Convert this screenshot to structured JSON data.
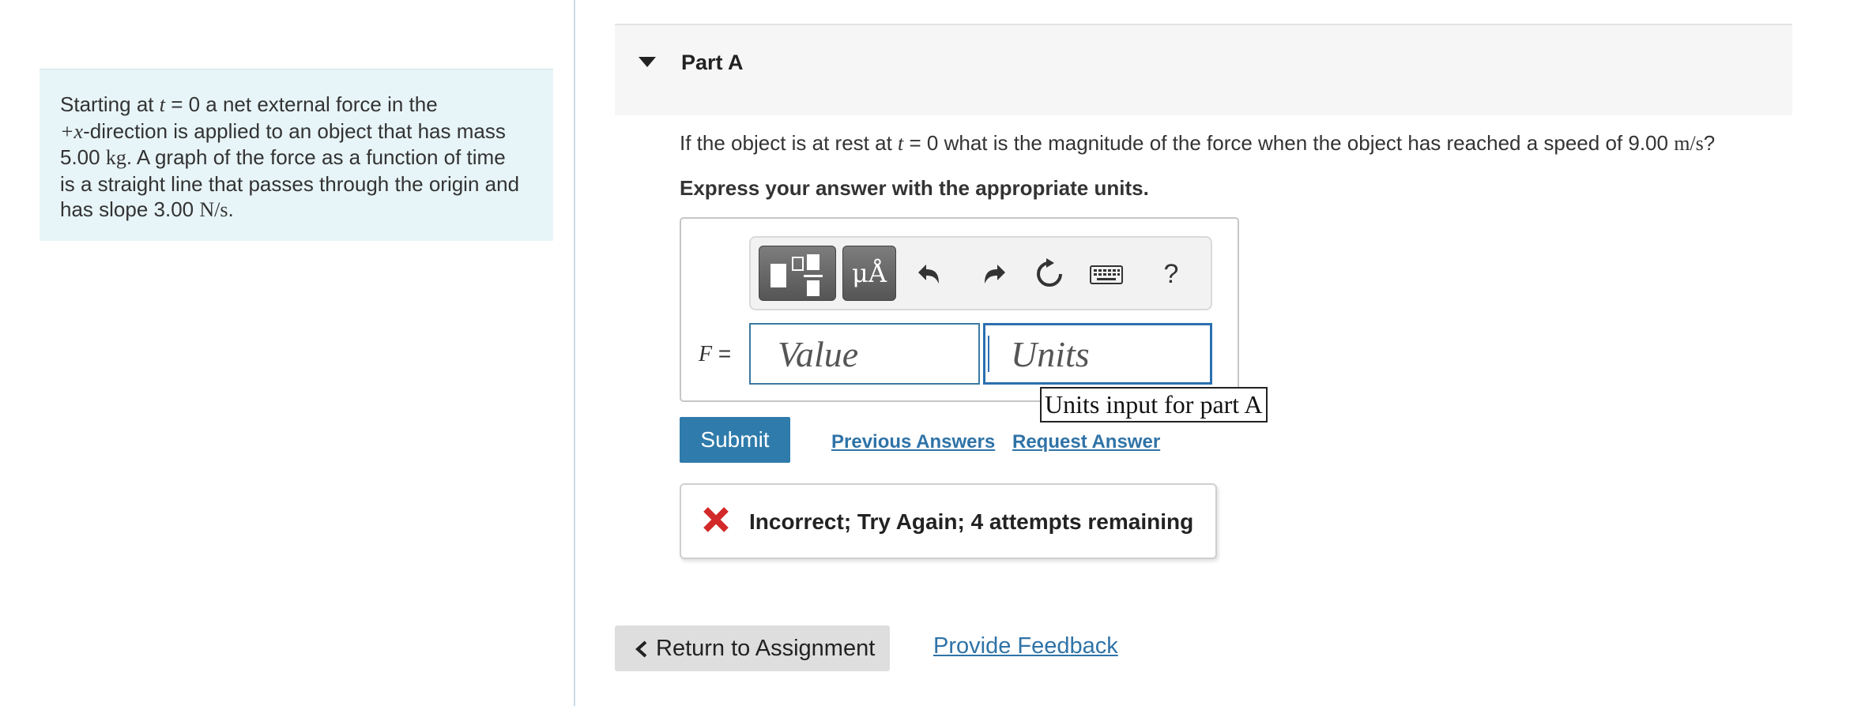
{
  "problem": {
    "p1": "Starting at ",
    "t": "t",
    "eq0": " = 0 a net external force in the",
    "plus_x": "+x",
    "p2": "-direction is applied to an object that has mass",
    "mass_value": "5.00 ",
    "mass_unit": "kg",
    "p3": ". A graph of the force as a function of time",
    "p4": "is a straight line that passes through the origin and",
    "p5": "has slope 3.00 ",
    "slope_unit": "N/s",
    "p6": "."
  },
  "part": {
    "title": "Part A"
  },
  "question": {
    "q1": "If the object is at rest at ",
    "t": "t",
    "q2": " = 0 what is the magnitude of the force when the object has reached a speed of 9.00 ",
    "unit": "m/s",
    "q3": "?"
  },
  "instruction": "Express your answer with the appropriate units.",
  "toolbar": {
    "units_label": "μÅ",
    "undo_glyph": "↶",
    "redo_glyph": "↷",
    "reset_glyph": "↻",
    "help_label": "?"
  },
  "answer": {
    "variable": "F",
    "equals": " =",
    "value_placeholder": "Value",
    "units_placeholder": "Units",
    "units_tooltip": "Units input for part A"
  },
  "actions": {
    "submit_label": "Submit",
    "previous_answers_label": "Previous Answers",
    "request_answer_label": "Request Answer"
  },
  "feedback": {
    "message": "Incorrect; Try Again; 4 attempts remaining"
  },
  "footer": {
    "return_label": "Return to Assignment",
    "provide_feedback_label": "Provide Feedback"
  },
  "colors": {
    "problem_bg": "#e8f5f8",
    "accent_blue": "#2f7bab",
    "error_red": "#d22a2a",
    "input_border": "#3a7aa0"
  }
}
